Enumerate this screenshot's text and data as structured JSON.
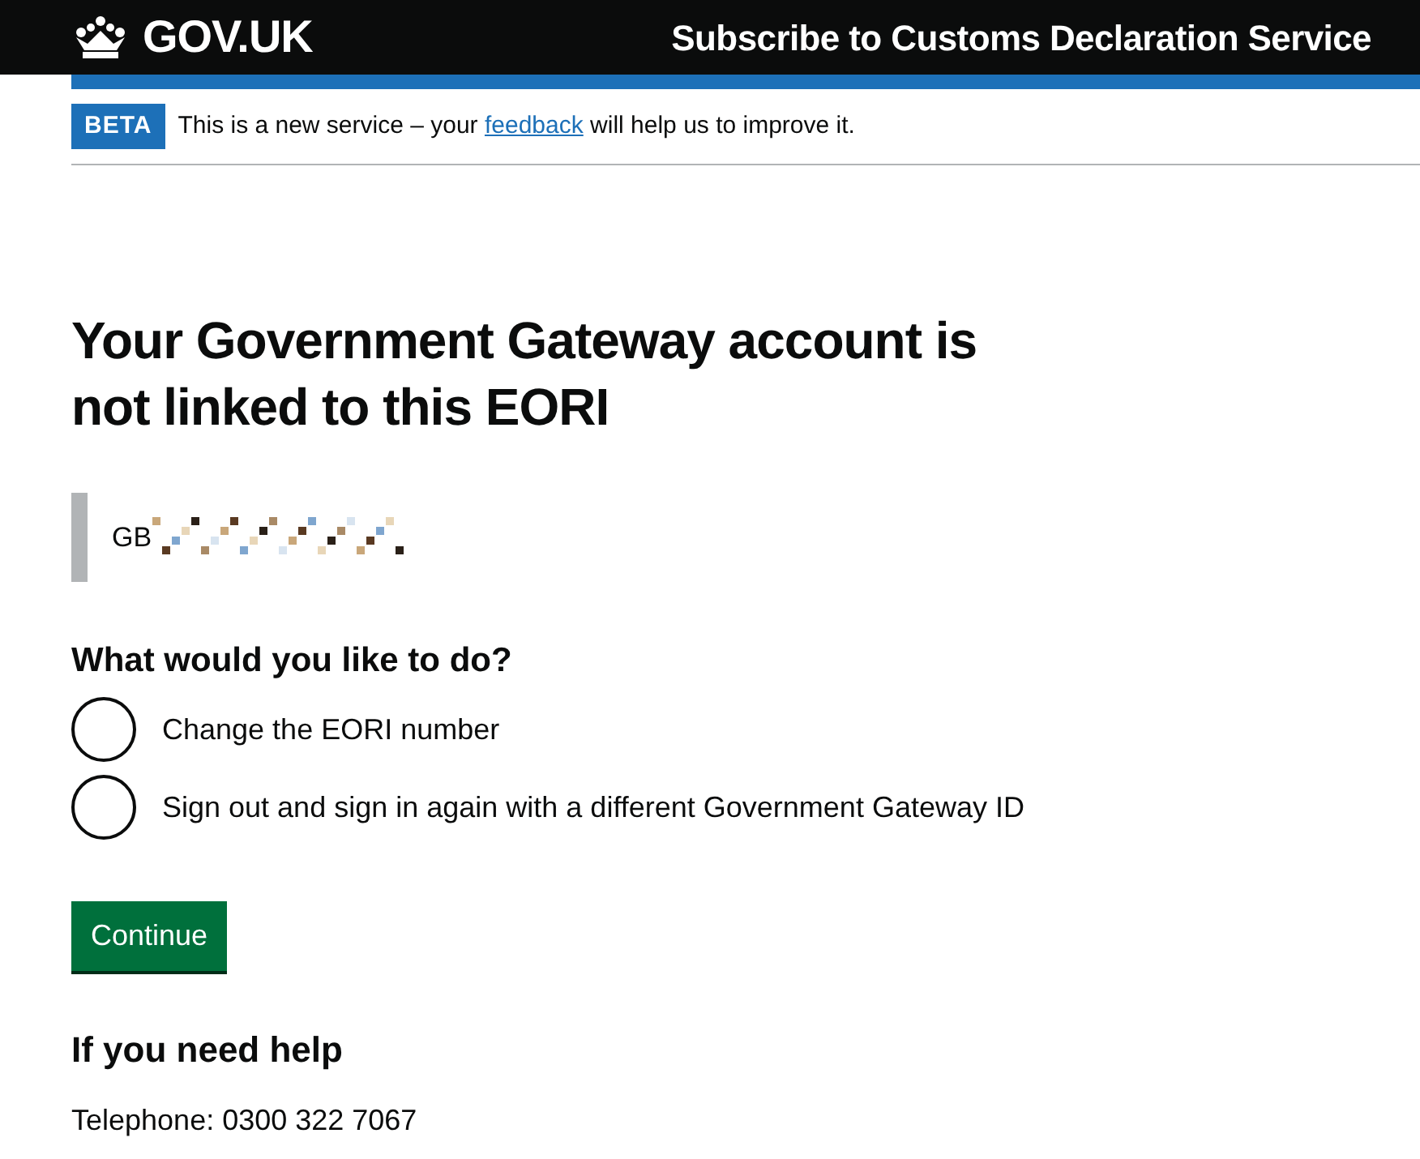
{
  "header": {
    "logo": "GOV.UK",
    "service_name": "Subscribe to Customs Declaration Service"
  },
  "phase_banner": {
    "tag": "BETA",
    "text_before": "This is a new service – your",
    "link": "feedback",
    "text_after": "will help us to improve it."
  },
  "heading": "Your Government Gateway account is not linked to this EORI",
  "inset": {
    "eori_prefix": "GB"
  },
  "question": "What would you like to do?",
  "options": [
    {
      "label": "Change the EORI number",
      "selected": false
    },
    {
      "label": "Sign out and sign in again with a different Government Gateway ID",
      "selected": false
    }
  ],
  "button": "Continue",
  "help": {
    "heading": "If you need help",
    "telephone": "Telephone: 0300 322 7067"
  }
}
